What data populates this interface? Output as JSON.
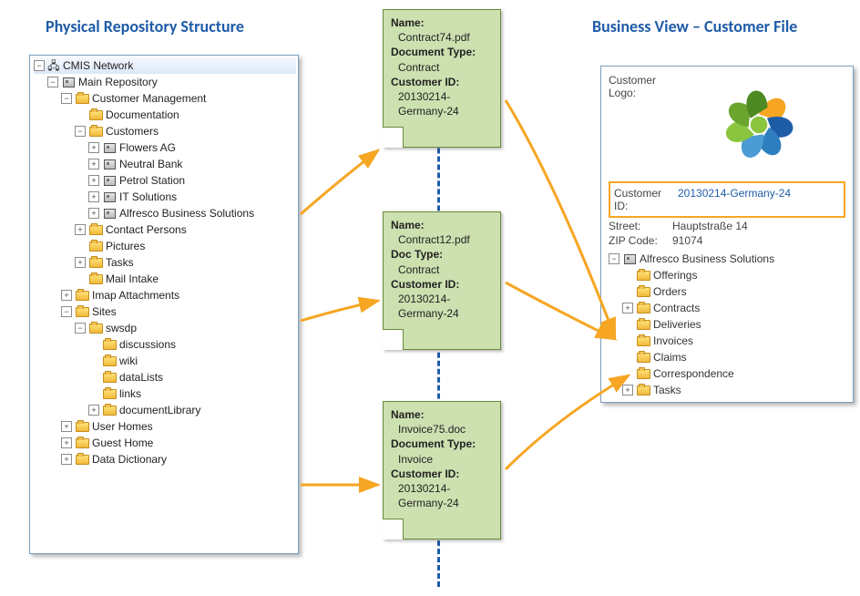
{
  "titles": {
    "left": "Physical Repository Structure",
    "right": "Business View – Customer File"
  },
  "tree": {
    "root": "CMIS Network",
    "main_repo": "Main Repository",
    "cust_mgmt": "Customer Management",
    "documentation": "Documentation",
    "customers": "Customers",
    "cust0": "Flowers AG",
    "cust1": "Neutral Bank",
    "cust2": "Petrol Station",
    "cust3": "IT Solutions",
    "cust4": "Alfresco Business Solutions",
    "contact": "Contact Persons",
    "pictures": "Pictures",
    "tasks": "Tasks",
    "mail": "Mail Intake",
    "imap": "Imap Attachments",
    "sites": "Sites",
    "swsdp": "swsdp",
    "sw0": "discussions",
    "sw1": "wiki",
    "sw2": "dataLists",
    "sw3": "links",
    "sw4": "documentLibrary",
    "userhomes": "User Homes",
    "guesthome": "Guest Home",
    "datadict": "Data Dictionary"
  },
  "docs": {
    "d1": {
      "name_l": "Name:",
      "name": "Contract74.pdf",
      "type_l": "Document Type:",
      "type": "Contract",
      "cid_l": "Customer ID:",
      "cid1": "20130214-",
      "cid2": "Germany-24"
    },
    "d2": {
      "name_l": "Name:",
      "name": "Contract12.pdf",
      "type_l": "Doc Type:",
      "type": "Contract",
      "cid_l": "Customer ID:",
      "cid1": "20130214-",
      "cid2": "Germany-24"
    },
    "d3": {
      "name_l": "Name:",
      "name": "Invoice75.doc",
      "type_l": "Document Type:",
      "type": "Invoice",
      "cid_l": "Customer ID:",
      "cid1": "20130214-",
      "cid2": "Germany-24"
    }
  },
  "bv": {
    "logo_l": "Customer Logo:",
    "cid_l": "Customer ID:",
    "cid": "20130214-Germany-24",
    "street_l": "Street:",
    "street": "Hauptstraße 14",
    "zip_l": "ZIP Code:",
    "zip": "91074",
    "root": "Alfresco Business Solutions",
    "f0": "Offerings",
    "f1": "Orders",
    "f2": "Contracts",
    "f3": "Deliveries",
    "f4": "Invoices",
    "f5": "Claims",
    "f6": "Correspondence",
    "f7": "Tasks"
  }
}
